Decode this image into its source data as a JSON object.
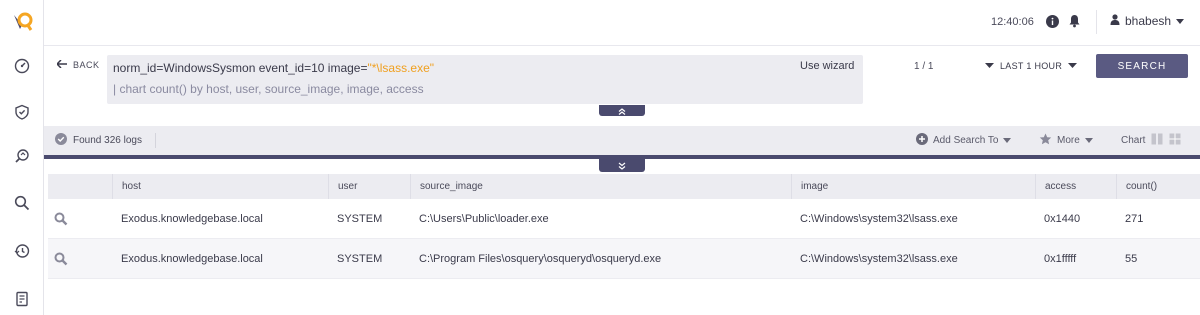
{
  "topbar": {
    "time": "12:40:06",
    "username": "bhabesh"
  },
  "search": {
    "back_label": "BACK",
    "query_part1": "norm_id=WindowsSysmon event_id=10 image=",
    "query_string": "\"*\\lsass.exe\"",
    "query_line2": "| chart count() by host, user, source_image, image, access",
    "use_wizard": "Use wizard",
    "pager": "1 / 1",
    "time_range": "LAST 1 HOUR",
    "search_button": "SEARCH"
  },
  "status": {
    "found": "Found 326 logs",
    "add_search_to": "Add Search To",
    "more": "More",
    "chart": "Chart"
  },
  "table": {
    "columns": [
      "host",
      "user",
      "source_image",
      "image",
      "access",
      "count()"
    ],
    "rows": [
      {
        "host": "Exodus.knowledgebase.local",
        "user": "SYSTEM",
        "source_image": "C:\\Users\\Public\\loader.exe",
        "image": "C:\\Windows\\system32\\lsass.exe",
        "access": "0x1440",
        "count": "271"
      },
      {
        "host": "Exodus.knowledgebase.local",
        "user": "SYSTEM",
        "source_image": "C:\\Program Files\\osquery\\osqueryd\\osqueryd.exe",
        "image": "C:\\Windows\\system32\\lsass.exe",
        "access": "0x1fffff",
        "count": "55"
      }
    ]
  },
  "colors": {
    "accent": "#5a5a82",
    "dark": "#4a4a6e",
    "query_string": "#f0a020",
    "logo": "#f5a623"
  }
}
